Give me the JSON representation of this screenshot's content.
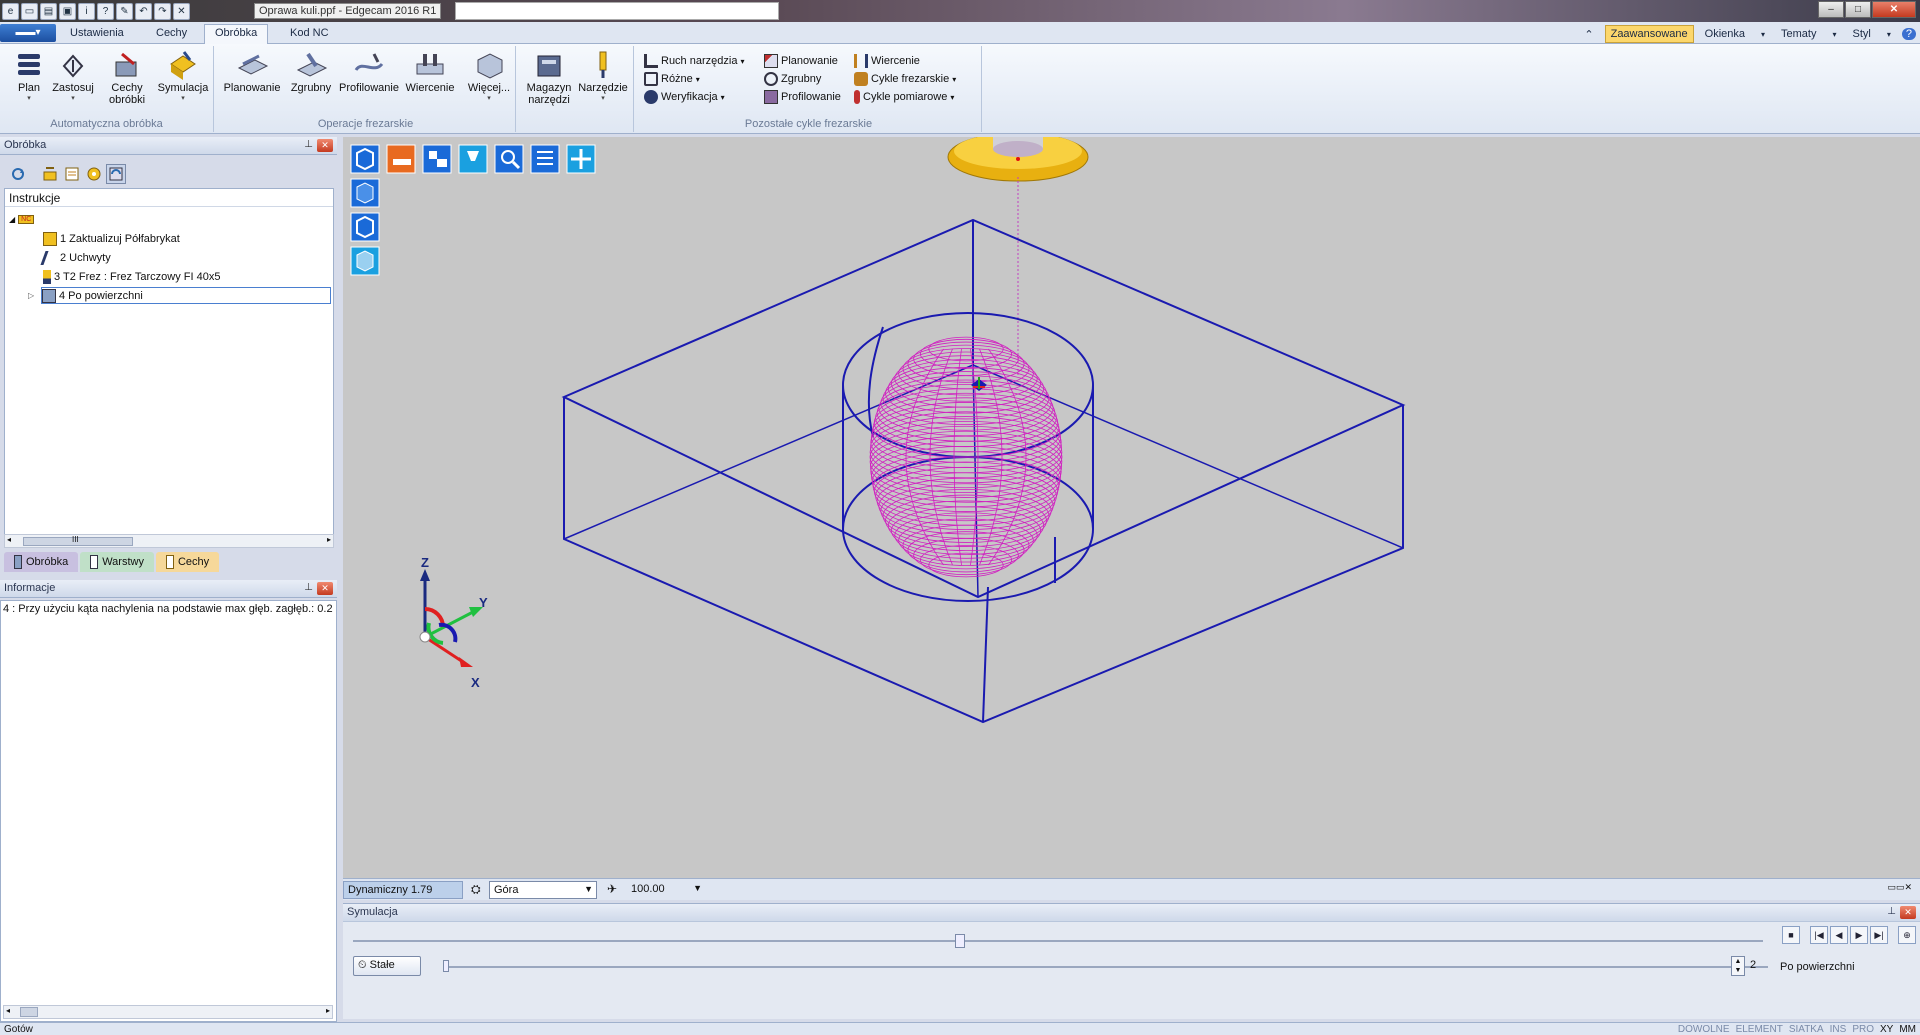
{
  "window": {
    "title": "Oprawa kuli.ppf - Edgecam 2016 R1",
    "qat_icons": [
      "new-icon",
      "open-icon",
      "save-icon",
      "info-icon",
      "help-icon",
      "tool-icon",
      "undo-icon",
      "redo-icon",
      "cancel-icon"
    ],
    "controls": {
      "minimize": "–",
      "maximize": "□",
      "close": "✕"
    }
  },
  "ribbon": {
    "app_button": "▬▬▾",
    "tabs": [
      {
        "label": "Ustawienia",
        "active": false
      },
      {
        "label": "Cechy",
        "active": false
      },
      {
        "label": "Obróbka",
        "active": true
      },
      {
        "label": "Kod NC",
        "active": false
      }
    ],
    "right": {
      "collapse": "⌃",
      "advanced": "Zaawansowane",
      "windows": "Okienka",
      "themes": "Tematy",
      "style": "Styl",
      "help": "?"
    },
    "groups": {
      "auto": {
        "label": "Automatyczna obróbka",
        "buttons": {
          "plan": "Plan",
          "zastosuj": "Zastosuj",
          "cechy": "Cechy obróbki",
          "symulacja": "Symulacja"
        }
      },
      "milling": {
        "label": "Operacje frezarskie",
        "buttons": {
          "planowanie": "Planowanie",
          "zgrubny": "Zgrubny",
          "profilowanie": "Profilowanie",
          "wiercenie": "Wiercenie",
          "wiecej": "Więcej..."
        }
      },
      "tools": {
        "buttons": {
          "magazyn": "Magazyn narzędzi",
          "narzedzie": "Narzędzie"
        }
      },
      "other_cycles": {
        "label": "Pozostałe cykle frezarskie",
        "col1": {
          "ruch": "Ruch narzędzia",
          "rozne": "Różne",
          "weryfikacja": "Weryfikacja"
        },
        "col2": {
          "planowanie": "Planowanie",
          "zgrubny": "Zgrubny",
          "profilowanie": "Profilowanie"
        },
        "col3": {
          "wiercenie": "Wiercenie",
          "cykle_frez": "Cykle frezarskie",
          "cykle_pom": "Cykle pomiarowe"
        }
      }
    }
  },
  "obrobka_panel": {
    "title": "Obróbka",
    "pin": "⊥",
    "tree_header": "Instrukcje",
    "root_icon": "NC",
    "items": [
      {
        "label": "1 Zaktualizuj Półfabrykat"
      },
      {
        "label": "2 Uchwyty"
      },
      {
        "label": "3 T2 Frez : Frez Tarczowy FI 40x5"
      },
      {
        "label": "4 Po powierzchni",
        "selected": true
      }
    ],
    "scroll_thumb": "III",
    "tabs": [
      "Obróbka",
      "Warstwy",
      "Cechy"
    ]
  },
  "info_panel": {
    "title": "Informacje",
    "text": "4 : Przy użyciu kąta nachylenia na podstawie max głęb. zagłęb.: 0.2"
  },
  "viewport": {
    "background": "#c7c7c7",
    "wire_color": "#1a1ab0",
    "path_color": "#d020c0",
    "tool_color": "#f0c020",
    "axes": {
      "x": "X",
      "y": "Y",
      "z": "Z"
    }
  },
  "viewbar": {
    "mode": "Dynamiczny 1.79",
    "view": "Góra",
    "zoom": "100.00"
  },
  "simulation": {
    "title": "Symulacja",
    "button": "Stałe",
    "spin_value": "2",
    "operation": "Po powierzchni",
    "controls": [
      "■",
      "|◀",
      "◀",
      "▶",
      "▶|",
      "⊕"
    ]
  },
  "status": {
    "left": "Gotów",
    "right": [
      {
        "label": "DOWOLNE",
        "on": false
      },
      {
        "label": "ELEMENT",
        "on": false
      },
      {
        "label": "SIATKA",
        "on": false
      },
      {
        "label": "INS",
        "on": false
      },
      {
        "label": "PRO",
        "on": false
      },
      {
        "label": "XY",
        "on": true
      },
      {
        "label": "MM",
        "on": true
      }
    ]
  }
}
